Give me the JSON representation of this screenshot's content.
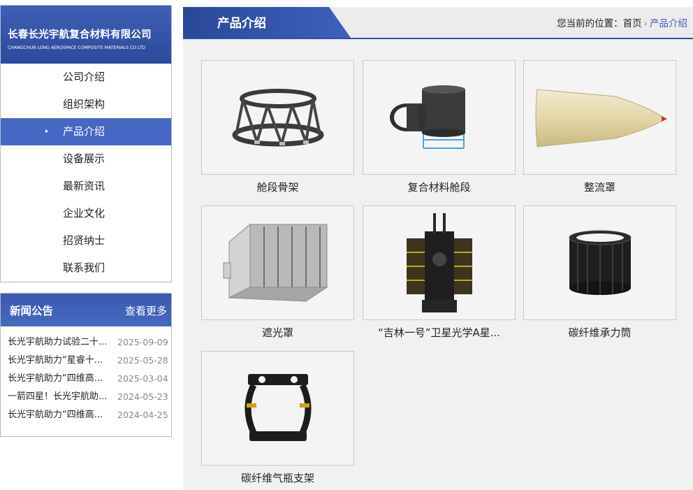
{
  "brand": {
    "name_cn": "长春长光宇航复合材料有限公司",
    "name_en": "CHANGCHUN LONG AEROSPACE COMPOSITE MATERIALS CO LTD"
  },
  "menu": {
    "items": [
      {
        "label": "公司介绍",
        "active": false
      },
      {
        "label": "组织架构",
        "active": false
      },
      {
        "label": "产品介绍",
        "active": true
      },
      {
        "label": "设备展示",
        "active": false
      },
      {
        "label": "最新资讯",
        "active": false
      },
      {
        "label": "企业文化",
        "active": false
      },
      {
        "label": "招贤纳士",
        "active": false
      },
      {
        "label": "联系我们",
        "active": false
      }
    ],
    "active_marker": "▸"
  },
  "news": {
    "title": "新闻公告",
    "more": "查看更多",
    "items": [
      {
        "title": "长光宇航助力试验二十...",
        "date": "2025-09-09"
      },
      {
        "title": "长光宇航助力“星睿十...",
        "date": "2025-05-28"
      },
      {
        "title": "长光宇航助力“四维高...",
        "date": "2025-03-04"
      },
      {
        "title": "一箭四星！长光宇航助...",
        "date": "2024-05-23"
      },
      {
        "title": "长光宇航助力“四维高...",
        "date": "2024-04-25"
      }
    ]
  },
  "section": {
    "title": "产品介绍",
    "breadcrumb_prefix": "您当前的位置：",
    "breadcrumb_home": "首页",
    "breadcrumb_sep": "›",
    "breadcrumb_current": "产品介绍"
  },
  "products": [
    {
      "name": "舱段骨架",
      "icon": "frame-structure-image"
    },
    {
      "name": "复合材料舱段",
      "icon": "composite-cabin-image"
    },
    {
      "name": "整流罩",
      "icon": "fairing-image"
    },
    {
      "name": "遮光罩",
      "icon": "light-shield-image"
    },
    {
      "name": "“吉林一号”卫星光学A星...",
      "icon": "satellite-image"
    },
    {
      "name": "碳纤维承力筒",
      "icon": "carbon-cylinder-image"
    },
    {
      "name": "碳纤维气瓶支架",
      "icon": "gas-bottle-bracket-image"
    }
  ],
  "colors": {
    "brand_blue": "#2c4a9c",
    "active_blue": "#4668c4",
    "link_blue": "#3a5ab8"
  }
}
